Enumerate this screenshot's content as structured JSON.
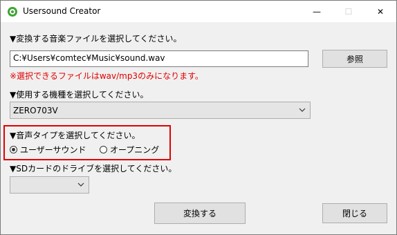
{
  "window": {
    "title": "Usersound Creator",
    "minimize_glyph": "—",
    "maximize_glyph": "☐",
    "close_glyph": "✕"
  },
  "file": {
    "label": "▼変換する音楽ファイルを選択してください。",
    "path_value": "C:¥Users¥comtec¥Music¥sound.wav",
    "browse_label": "参照",
    "warning": "※選択できるファイルはwav/mp3のみになります。"
  },
  "model": {
    "label": "▼使用する機種を選択してください。",
    "selected": "ZERO703V"
  },
  "voice_type": {
    "label": "▼音声タイプを選択してください。",
    "options": [
      {
        "label": "ユーザーサウンド",
        "checked": true
      },
      {
        "label": "オープニング",
        "checked": false
      }
    ]
  },
  "sd": {
    "label": "▼SDカードのドライブを選択してください。",
    "selected": ""
  },
  "actions": {
    "convert_label": "変換する",
    "close_label": "閉じる"
  },
  "colors": {
    "warning": "#e00000",
    "highlight_border": "#e00000"
  },
  "icons": {
    "app": "app-logo-icon",
    "dropdown": "chevron-down-icon"
  }
}
